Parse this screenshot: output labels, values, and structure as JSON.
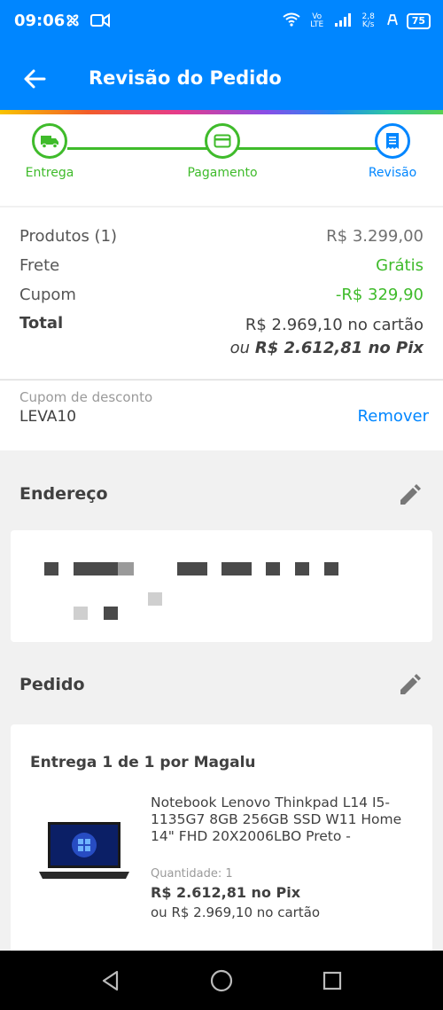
{
  "status": {
    "time": "09:06",
    "network": "Vo LTE",
    "speed": "2,8 K/s",
    "battery": "75"
  },
  "header": {
    "title": "Revisão do Pedido"
  },
  "stepper": {
    "steps": [
      {
        "label": "Entrega"
      },
      {
        "label": "Pagamento"
      },
      {
        "label": "Revisão"
      }
    ]
  },
  "summary": {
    "products_label": "Produtos (1)",
    "products_value": "R$ 3.299,00",
    "shipping_label": "Frete",
    "shipping_value": "Grátis",
    "coupon_label": "Cupom",
    "coupon_value": "-R$ 329,90",
    "total_label": "Total",
    "total_card": "R$ 2.969,10 no cartão",
    "total_pix_prefix": "ou ",
    "total_pix": "R$ 2.612,81 no Pix"
  },
  "coupon": {
    "label": "Cupom de desconto",
    "code": "LEVA10",
    "remove": "Remover"
  },
  "address": {
    "title": "Endereço"
  },
  "order": {
    "title": "Pedido",
    "delivery": "Entrega 1 de 1 por Magalu",
    "product": {
      "name": "Notebook Lenovo Thinkpad L14 I5-1135G7 8GB 256GB SSD W11 Home 14\" FHD 20X2006LBO Preto -",
      "quantity": "Quantidade:  1",
      "price_pix": "R$ 2.612,81 no Pix",
      "price_card": "ou R$ 2.969,10 no cartão"
    }
  },
  "colors": {
    "primary": "#0086ff",
    "success": "#3fbb2b",
    "text": "#404040"
  }
}
